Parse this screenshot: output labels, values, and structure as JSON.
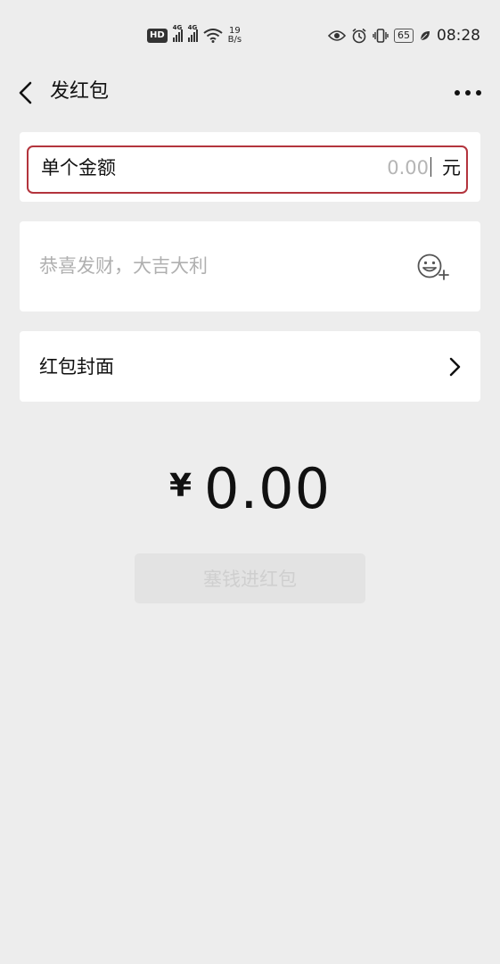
{
  "status_bar": {
    "hd": "HD",
    "net1": "4G",
    "net2": "4G",
    "speed_value": "19",
    "speed_unit": "B/s",
    "battery": "65",
    "time": "08:28"
  },
  "nav": {
    "title": "发红包",
    "back_icon": "chevron-left-icon",
    "more_icon": "more-dots-icon"
  },
  "amount": {
    "label": "单个金额",
    "value": "",
    "placeholder": "0.00",
    "unit": "元"
  },
  "greeting": {
    "value": "",
    "placeholder": "恭喜发财，大吉大利",
    "icon": "emoji-add-icon"
  },
  "cover": {
    "label": "红包封面",
    "icon": "chevron-right-icon"
  },
  "total": {
    "currency": "¥",
    "value": "0.00"
  },
  "submit": {
    "label": "塞钱进红包"
  },
  "colors": {
    "background": "#ededed",
    "card": "#ffffff",
    "highlight_border": "#b3343d",
    "placeholder": "#b5b5b5",
    "button_disabled_bg": "#e3e3e3",
    "button_disabled_text": "#cfcfcf"
  }
}
